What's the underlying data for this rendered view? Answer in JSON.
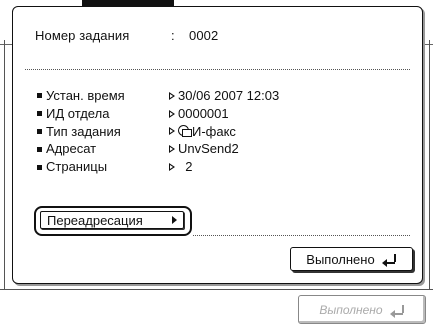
{
  "job": {
    "label": "Номер задания",
    "colon": ":",
    "value": "0002"
  },
  "details": [
    {
      "label": "Устан. время",
      "value": "30/06 2007 12:03"
    },
    {
      "label": "ИД отдела",
      "value": "0000001"
    },
    {
      "label": "Тип задания",
      "value": "И-факс",
      "icon": "ifax-icon"
    },
    {
      "label": "Адресат",
      "value": "UnvSend2"
    },
    {
      "label": "Страницы",
      "value": "  2"
    }
  ],
  "buttons": {
    "redirect_label": "Переадресация",
    "done_label": "Выполнено",
    "background_done_label": "Выполнено"
  },
  "colors": {
    "border": "#111111",
    "background": "#ffffff",
    "disabled_text": "#aaaaaa"
  }
}
